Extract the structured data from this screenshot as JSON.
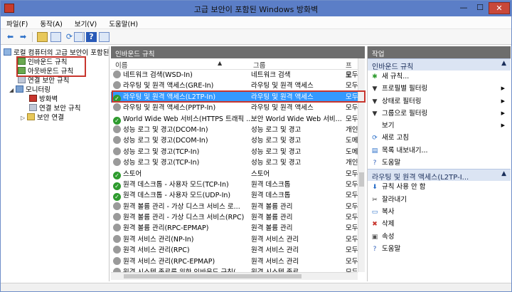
{
  "window": {
    "title": "고급 보안이 포함된 Windows 방화벽",
    "minimize": "—",
    "maximize": "☐",
    "close": "✕"
  },
  "menu": [
    "파일(F)",
    "동작(A)",
    "보기(V)",
    "도움말(H)"
  ],
  "tree": {
    "root": "로컬 컴퓨터의 고급 보안이 포함된...",
    "inbound": "인바운드 규칙",
    "outbound": "아웃바운드 규칙",
    "connection_security": "연결 보안 규칙",
    "monitoring": "모니터링",
    "firewall": "방화벽",
    "monitor_connection_security": "연결 보안 규칙",
    "security_associations": "보안 연결"
  },
  "center": {
    "panel_title": "인바운드 규칙",
    "columns": {
      "name": "이름",
      "group": "그룹",
      "profile": "프로"
    },
    "rows": [
      {
        "name": "네트워크 검색(WSD-In)",
        "group": "네트워크 검색",
        "profile": "모두",
        "enabled": false,
        "selected": false
      },
      {
        "name": "라우팅 및 원격 액세스(GRE-In)",
        "group": "라우팅 및 원격 액세스",
        "profile": "모두",
        "enabled": false,
        "selected": false
      },
      {
        "name": "라우팅 및 원격 액세스(L2TP-In)",
        "group": "라우팅 및 원격 액세스",
        "profile": "모두",
        "enabled": true,
        "selected": true
      },
      {
        "name": "라우팅 및 원격 액세스(PPTP-In)",
        "group": "라우팅 및 원격 액세스",
        "profile": "모두",
        "enabled": false,
        "selected": false
      },
      {
        "name": "World Wide Web 서비스(HTTPS 트래픽 ...",
        "group": "보안 World Wide Web 서비...",
        "profile": "모두",
        "enabled": true,
        "selected": false
      },
      {
        "name": "성능 로그 및 경고(DCOM-In)",
        "group": "성능 로그 및 경고",
        "profile": "개인",
        "enabled": false,
        "selected": false
      },
      {
        "name": "성능 로그 및 경고(DCOM-In)",
        "group": "성능 로그 및 경고",
        "profile": "도메",
        "enabled": false,
        "selected": false
      },
      {
        "name": "성능 로그 및 경고(TCP-In)",
        "group": "성능 로그 및 경고",
        "profile": "도메",
        "enabled": false,
        "selected": false
      },
      {
        "name": "성능 로그 및 경고(TCP-In)",
        "group": "성능 로그 및 경고",
        "profile": "개인",
        "enabled": false,
        "selected": false
      },
      {
        "name": "스토어",
        "group": "스토어",
        "profile": "모두",
        "enabled": true,
        "selected": false
      },
      {
        "name": "원격 데스크톱 - 사용자 모드(TCP-In)",
        "group": "원격 데스크톱",
        "profile": "모두",
        "enabled": true,
        "selected": false
      },
      {
        "name": "원격 데스크톱 - 사용자 모드(UDP-In)",
        "group": "원격 데스크톱",
        "profile": "모두",
        "enabled": true,
        "selected": false
      },
      {
        "name": "원격 볼륨 관리 - 가상 디스크 서비스 로...",
        "group": "원격 볼륨 관리",
        "profile": "모두",
        "enabled": false,
        "selected": false
      },
      {
        "name": "원격 볼륨 관리 - 가상 디스크 서비스(RPC)",
        "group": "원격 볼륨 관리",
        "profile": "모두",
        "enabled": false,
        "selected": false
      },
      {
        "name": "원격 볼륨 관리(RPC-EPMAP)",
        "group": "원격 볼륨 관리",
        "profile": "모두",
        "enabled": false,
        "selected": false
      },
      {
        "name": "원격 서비스 관리(NP-In)",
        "group": "원격 서비스 관리",
        "profile": "모두",
        "enabled": false,
        "selected": false
      },
      {
        "name": "원격 서비스 관리(RPC)",
        "group": "원격 서비스 관리",
        "profile": "모두",
        "enabled": false,
        "selected": false
      },
      {
        "name": "원격 서비스 관리(RPC-EPMAP)",
        "group": "원격 서비스 관리",
        "profile": "모두",
        "enabled": false,
        "selected": false
      },
      {
        "name": "원격 시스템 종료를 위한 인바운드 규칙(...",
        "group": "원격 시스템 종료",
        "profile": "모두",
        "enabled": false,
        "selected": false
      }
    ]
  },
  "actions": {
    "panel_title": "작업",
    "section1": "인바운드 규칙",
    "section1_items": [
      "새 규칙...",
      "프로필별 필터링",
      "상태로 필터링",
      "그룹으로 필터링",
      "보기",
      "새로 고침",
      "목록 내보내기...",
      "도움말"
    ],
    "section2": "라우팅 및 원격 액세스(L2TP-I...",
    "section2_items": [
      "규칙 사용 안 함",
      "잘라내기",
      "복사",
      "삭제",
      "속성",
      "도움말"
    ]
  },
  "colors": {
    "highlight_box": "#c8362e",
    "selection": "#3399ff",
    "enabled": "#2e9b2e",
    "disabled": "#9a9a9a",
    "panel_header": "#6d6d6d"
  }
}
